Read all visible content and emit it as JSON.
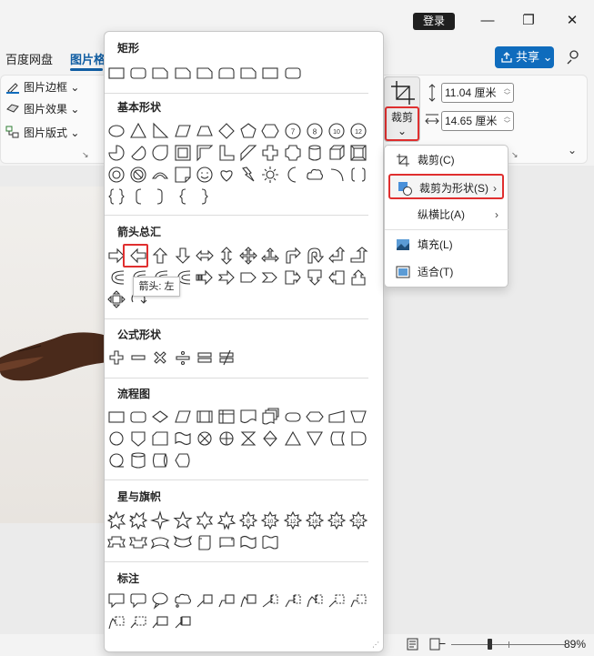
{
  "titlebar": {
    "login": "登录"
  },
  "tabs": {
    "baidu": "百度网盘",
    "picture_format": "图片格"
  },
  "share": {
    "label": "共享"
  },
  "ribbon": {
    "border": "图片边框",
    "effect": "图片效果",
    "layout": "图片版式",
    "crop": "裁剪",
    "height": "11.04 厘米",
    "width": "14.65 厘米"
  },
  "gallery": {
    "sections": {
      "rect": "矩形",
      "basic": "基本形状",
      "arrows": "箭头总汇",
      "equation": "公式形状",
      "flowchart": "流程图",
      "stars": "星与旗帜",
      "callouts": "标注"
    },
    "tooltip": "箭头: 左"
  },
  "crop_menu": {
    "crop": "裁剪(C)",
    "crop_to_shape": "裁剪为形状(S)",
    "aspect": "纵横比(A)",
    "fill": "填充(L)",
    "fit": "适合(T)"
  },
  "status": {
    "zoom": "89%"
  },
  "colors": {
    "accent": "#0f6cbd",
    "highlight": "#e02f2f"
  }
}
